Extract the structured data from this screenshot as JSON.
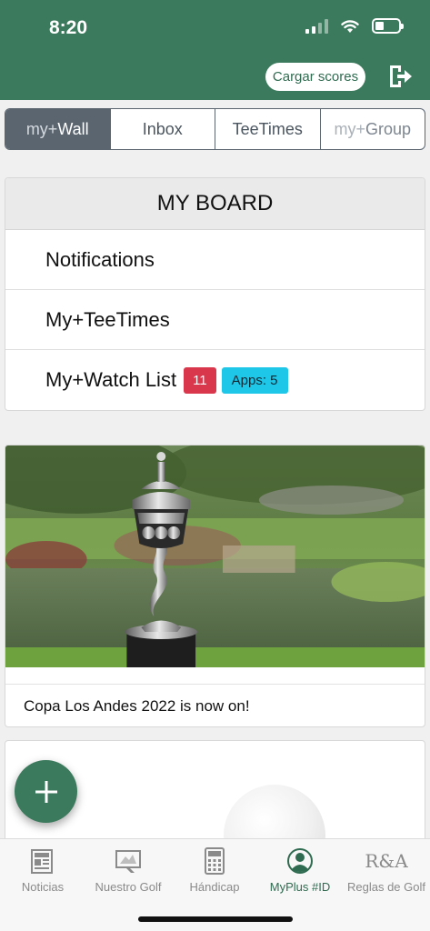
{
  "status_bar": {
    "time": "8:20"
  },
  "header": {
    "upload_scores_label": "Cargar scores"
  },
  "segments": [
    {
      "prefix": "my+",
      "label": "Wall"
    },
    {
      "prefix": "",
      "label": "Inbox"
    },
    {
      "prefix": "",
      "label": "TeeTimes"
    },
    {
      "prefix": "my+",
      "label": "Group"
    }
  ],
  "board": {
    "title": "MY BOARD",
    "rows": [
      {
        "label": "Notifications"
      },
      {
        "label": "My+TeeTimes"
      },
      {
        "label": "My+Watch List",
        "badge_count": "11",
        "badge_apps": "Apps: 5"
      }
    ]
  },
  "news": {
    "caption": "Copa Los Andes 2022 is now on!"
  },
  "tabbar": {
    "items": [
      {
        "label": "Noticias",
        "icon": "newspaper-icon"
      },
      {
        "label": "Nuestro Golf",
        "icon": "golf-course-icon"
      },
      {
        "label": "Hándicap",
        "icon": "calculator-icon"
      },
      {
        "label": "MyPlus #ID",
        "icon": "user-icon",
        "active": true
      },
      {
        "label": "Reglas de Golf",
        "icon": "r-and-a-logo-icon",
        "logo_text": "R&A"
      }
    ]
  },
  "colors": {
    "brand_green": "#3b7a5c",
    "badge_red": "#d9374b",
    "badge_cyan": "#1ec6e8",
    "segment_active": "#5b6570"
  }
}
